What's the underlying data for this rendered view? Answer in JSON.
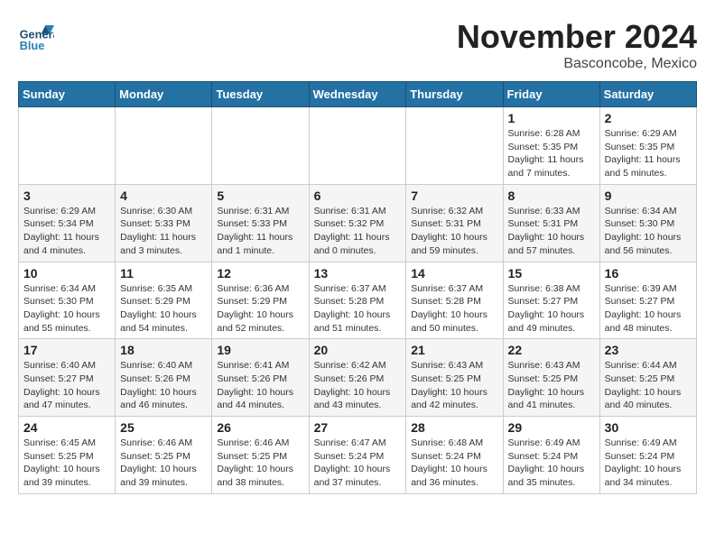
{
  "header": {
    "logo_line1": "General",
    "logo_line2": "Blue",
    "month": "November 2024",
    "location": "Basconcobe, Mexico"
  },
  "weekdays": [
    "Sunday",
    "Monday",
    "Tuesday",
    "Wednesday",
    "Thursday",
    "Friday",
    "Saturday"
  ],
  "weeks": [
    [
      {
        "day": "",
        "info": ""
      },
      {
        "day": "",
        "info": ""
      },
      {
        "day": "",
        "info": ""
      },
      {
        "day": "",
        "info": ""
      },
      {
        "day": "",
        "info": ""
      },
      {
        "day": "1",
        "info": "Sunrise: 6:28 AM\nSunset: 5:35 PM\nDaylight: 11 hours and 7 minutes."
      },
      {
        "day": "2",
        "info": "Sunrise: 6:29 AM\nSunset: 5:35 PM\nDaylight: 11 hours and 5 minutes."
      }
    ],
    [
      {
        "day": "3",
        "info": "Sunrise: 6:29 AM\nSunset: 5:34 PM\nDaylight: 11 hours and 4 minutes."
      },
      {
        "day": "4",
        "info": "Sunrise: 6:30 AM\nSunset: 5:33 PM\nDaylight: 11 hours and 3 minutes."
      },
      {
        "day": "5",
        "info": "Sunrise: 6:31 AM\nSunset: 5:33 PM\nDaylight: 11 hours and 1 minute."
      },
      {
        "day": "6",
        "info": "Sunrise: 6:31 AM\nSunset: 5:32 PM\nDaylight: 11 hours and 0 minutes."
      },
      {
        "day": "7",
        "info": "Sunrise: 6:32 AM\nSunset: 5:31 PM\nDaylight: 10 hours and 59 minutes."
      },
      {
        "day": "8",
        "info": "Sunrise: 6:33 AM\nSunset: 5:31 PM\nDaylight: 10 hours and 57 minutes."
      },
      {
        "day": "9",
        "info": "Sunrise: 6:34 AM\nSunset: 5:30 PM\nDaylight: 10 hours and 56 minutes."
      }
    ],
    [
      {
        "day": "10",
        "info": "Sunrise: 6:34 AM\nSunset: 5:30 PM\nDaylight: 10 hours and 55 minutes."
      },
      {
        "day": "11",
        "info": "Sunrise: 6:35 AM\nSunset: 5:29 PM\nDaylight: 10 hours and 54 minutes."
      },
      {
        "day": "12",
        "info": "Sunrise: 6:36 AM\nSunset: 5:29 PM\nDaylight: 10 hours and 52 minutes."
      },
      {
        "day": "13",
        "info": "Sunrise: 6:37 AM\nSunset: 5:28 PM\nDaylight: 10 hours and 51 minutes."
      },
      {
        "day": "14",
        "info": "Sunrise: 6:37 AM\nSunset: 5:28 PM\nDaylight: 10 hours and 50 minutes."
      },
      {
        "day": "15",
        "info": "Sunrise: 6:38 AM\nSunset: 5:27 PM\nDaylight: 10 hours and 49 minutes."
      },
      {
        "day": "16",
        "info": "Sunrise: 6:39 AM\nSunset: 5:27 PM\nDaylight: 10 hours and 48 minutes."
      }
    ],
    [
      {
        "day": "17",
        "info": "Sunrise: 6:40 AM\nSunset: 5:27 PM\nDaylight: 10 hours and 47 minutes."
      },
      {
        "day": "18",
        "info": "Sunrise: 6:40 AM\nSunset: 5:26 PM\nDaylight: 10 hours and 46 minutes."
      },
      {
        "day": "19",
        "info": "Sunrise: 6:41 AM\nSunset: 5:26 PM\nDaylight: 10 hours and 44 minutes."
      },
      {
        "day": "20",
        "info": "Sunrise: 6:42 AM\nSunset: 5:26 PM\nDaylight: 10 hours and 43 minutes."
      },
      {
        "day": "21",
        "info": "Sunrise: 6:43 AM\nSunset: 5:25 PM\nDaylight: 10 hours and 42 minutes."
      },
      {
        "day": "22",
        "info": "Sunrise: 6:43 AM\nSunset: 5:25 PM\nDaylight: 10 hours and 41 minutes."
      },
      {
        "day": "23",
        "info": "Sunrise: 6:44 AM\nSunset: 5:25 PM\nDaylight: 10 hours and 40 minutes."
      }
    ],
    [
      {
        "day": "24",
        "info": "Sunrise: 6:45 AM\nSunset: 5:25 PM\nDaylight: 10 hours and 39 minutes."
      },
      {
        "day": "25",
        "info": "Sunrise: 6:46 AM\nSunset: 5:25 PM\nDaylight: 10 hours and 39 minutes."
      },
      {
        "day": "26",
        "info": "Sunrise: 6:46 AM\nSunset: 5:25 PM\nDaylight: 10 hours and 38 minutes."
      },
      {
        "day": "27",
        "info": "Sunrise: 6:47 AM\nSunset: 5:24 PM\nDaylight: 10 hours and 37 minutes."
      },
      {
        "day": "28",
        "info": "Sunrise: 6:48 AM\nSunset: 5:24 PM\nDaylight: 10 hours and 36 minutes."
      },
      {
        "day": "29",
        "info": "Sunrise: 6:49 AM\nSunset: 5:24 PM\nDaylight: 10 hours and 35 minutes."
      },
      {
        "day": "30",
        "info": "Sunrise: 6:49 AM\nSunset: 5:24 PM\nDaylight: 10 hours and 34 minutes."
      }
    ]
  ]
}
